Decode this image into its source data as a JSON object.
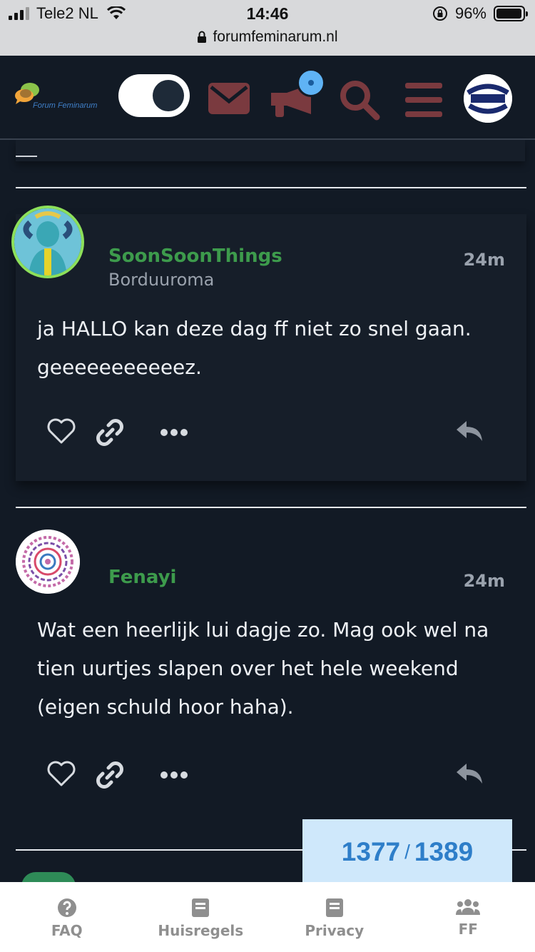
{
  "status_bar": {
    "carrier": "Tele2 NL",
    "time": "14:46",
    "battery": "96%",
    "battery_level": 0.96,
    "url": "forumfeminarum.nl"
  },
  "header": {
    "logo_text": "Forum Feminarum",
    "theme_toggle": "dark",
    "avatar_text": "SALTY"
  },
  "posts": [
    {
      "username": "SoonSoonThings",
      "user_title": "Borduuroma",
      "time": "24m",
      "body": "ja HALLO kan deze dag ff niet zo snel gaan. geeeeeeeeeeez."
    },
    {
      "username": "Fenayi",
      "user_title": "",
      "time": "24m",
      "body": "Wat een heerlijk lui dagje zo. Mag ook wel na tien uurtjes slapen over het hele weekend (eigen schuld hoor haha)."
    }
  ],
  "progress": {
    "current": "1377",
    "separator": "/",
    "total": "1389"
  },
  "footer": {
    "items": [
      {
        "label": "FAQ",
        "icon": "question-circle-icon"
      },
      {
        "label": "Huisregels",
        "icon": "book-icon"
      },
      {
        "label": "Privacy",
        "icon": "book-icon"
      },
      {
        "label": "FF",
        "icon": "users-icon"
      }
    ]
  },
  "colors": {
    "background": "#121a25",
    "card": "#161e29",
    "username": "#3d9b4c",
    "header_icons": "#7a3a3f",
    "progress_bg": "#cfe8fb",
    "progress_text": "#2e7ec9"
  }
}
